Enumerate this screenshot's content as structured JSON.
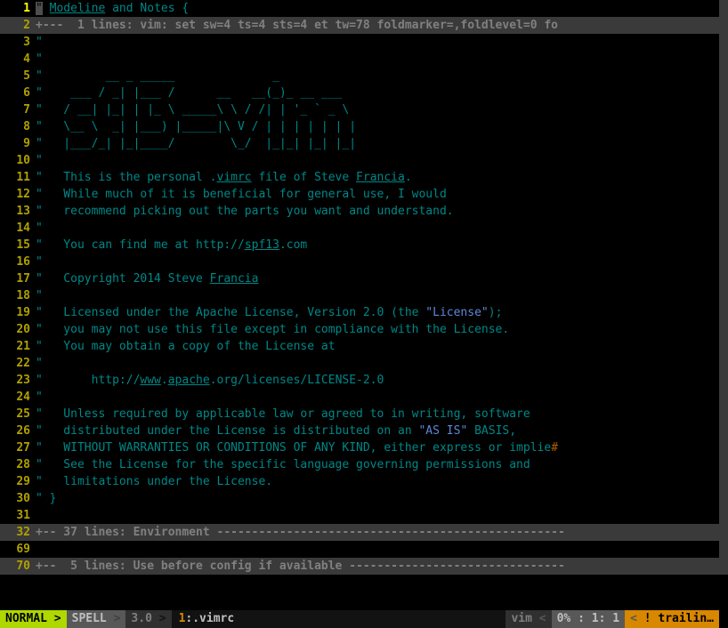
{
  "lines": [
    {
      "n": 1,
      "cls": "current",
      "pre": "",
      "cursor": "\"",
      "post": " ",
      "mid": "Modeline",
      "post2": " and Notes {"
    },
    {
      "n": 2,
      "fold": true,
      "text": "+---  1 lines: vim: set sw=4 ts=4 sts=4 et tw=78 foldmarker=,foldlevel=0 fo"
    },
    {
      "n": 3,
      "text": "\""
    },
    {
      "n": 4,
      "text": "\""
    },
    {
      "n": 5,
      "text": "\"         __ _ _____              _"
    },
    {
      "n": 6,
      "text": "\"    ___ / _| |___ /      __   __(_)_ __ ___"
    },
    {
      "n": 7,
      "text": "\"   / __| |_| | |_ \\ _____\\ \\ / /| | '_ ` _ \\"
    },
    {
      "n": 8,
      "text": "\"   \\__ \\  _| |___) |_____|\\ V / | | | | | | |"
    },
    {
      "n": 9,
      "text": "\"   |___/_| |_|____/        \\_/  |_|_| |_| |_|"
    },
    {
      "n": 10,
      "text": "\""
    },
    {
      "n": 11,
      "pre": "\"   This is the personal .",
      "u1": "vimrc",
      "mid": " file of Steve ",
      "u2": "Francia",
      "post": "."
    },
    {
      "n": 12,
      "text": "\"   While much of it is beneficial for general use, I would"
    },
    {
      "n": 13,
      "text": "\"   recommend picking out the parts you want and understand."
    },
    {
      "n": 14,
      "text": "\""
    },
    {
      "n": 15,
      "pre": "\"   You can find me at http://",
      "u1": "spf13",
      "post": ".com"
    },
    {
      "n": 16,
      "text": "\""
    },
    {
      "n": 17,
      "pre": "\"   Copyright 2014 Steve ",
      "u1": "Francia",
      "post": ""
    },
    {
      "n": 18,
      "text": "\""
    },
    {
      "n": 19,
      "pre": "\"   Licensed under the Apache License, Version 2.0 (the ",
      "kw": "\"License\"",
      "post": ");"
    },
    {
      "n": 20,
      "text": "\"   you may not use this file except in compliance with the License."
    },
    {
      "n": 21,
      "text": "\"   You may obtain a copy of the License at"
    },
    {
      "n": 22,
      "text": "\""
    },
    {
      "n": 23,
      "pre": "\"       http://",
      "u1": "www",
      "mid": ".",
      "u2": "apache",
      "post": ".org/licenses/LICENSE-2.0"
    },
    {
      "n": 24,
      "text": "\""
    },
    {
      "n": 25,
      "text": "\"   Unless required by applicable law or agreed to in writing, software"
    },
    {
      "n": 26,
      "pre": "\"   distributed under the License is distributed on an ",
      "kw": "\"AS IS\"",
      "post": " BASIS,"
    },
    {
      "n": 27,
      "text": "\"   WITHOUT WARRANTIES OR CONDITIONS OF ANY KIND, either express or implie",
      "eol": "#"
    },
    {
      "n": 28,
      "text": "\"   See the License for the specific language governing permissions and"
    },
    {
      "n": 29,
      "text": "\"   limitations under the License."
    },
    {
      "n": 30,
      "text": "\" }"
    },
    {
      "n": 31,
      "text": ""
    },
    {
      "n": 32,
      "fold": true,
      "text": "+-- 37 lines: Environment --------------------------------------------------"
    },
    {
      "n": 69,
      "text": ""
    },
    {
      "n": 70,
      "fold": true,
      "text": "+--  5 lines: Use before config if available -------------------------------"
    }
  ],
  "status": {
    "mode": "NORMAL",
    "spell": "SPELL",
    "ver": "3.0",
    "filenum": "1",
    "filename": ":.vimrc",
    "ft": "vim",
    "pct": "0%",
    "row": "1",
    "col": "1",
    "warn": "! trailin…"
  }
}
